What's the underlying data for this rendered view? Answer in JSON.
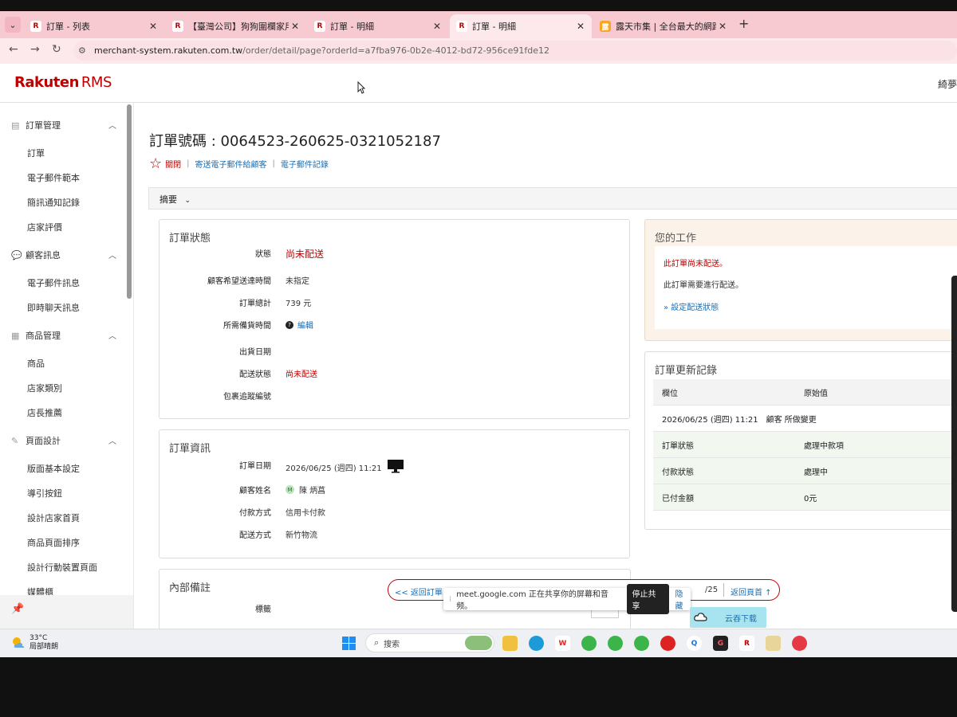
{
  "browser": {
    "tabs": [
      {
        "title": "訂單 - 列表",
        "favicon": "R",
        "active": false
      },
      {
        "title": "【臺灣公司】狗狗圍欄家用狗籠",
        "favicon": "R",
        "active": false
      },
      {
        "title": "訂單 - 明細",
        "favicon": "R",
        "active": false
      },
      {
        "title": "訂單 - 明細",
        "favicon": "R",
        "active": true
      },
      {
        "title": "露天市集 | 全台最大的網路購物",
        "favicon": "Y",
        "active": false
      }
    ],
    "url_host": "merchant-system.rakuten.com.tw",
    "url_path": "/order/detail/page?orderId=a7fba976-0b2e-4012-bd72-956ce91fde12"
  },
  "header": {
    "logo": "Rakuten",
    "logo_suffix": "RMS",
    "user_fragment": "綺夢"
  },
  "sidebar": {
    "sections": [
      {
        "label": "訂單管理",
        "icon": "document-icon",
        "items": [
          "訂單",
          "電子郵件範本",
          "簡訊通知記錄",
          "店家評價"
        ]
      },
      {
        "label": "顧客訊息",
        "icon": "chat-icon",
        "items": [
          "電子郵件訊息",
          "即時聊天訊息"
        ]
      },
      {
        "label": "商品管理",
        "icon": "table-icon",
        "items": [
          "商品",
          "店家類別",
          "店長推薦"
        ]
      },
      {
        "label": "頁面設計",
        "icon": "pencil-icon",
        "items": [
          "版面基本設定",
          "導引按鈕",
          "設計店家首頁",
          "商品頁面排序",
          "設計行動裝置頁面",
          "媒體櫃"
        ]
      }
    ]
  },
  "order": {
    "title": "訂單號碼 : 0064523-260625-0321052187",
    "close_link": "關閉",
    "email_link": "寄送電子郵件給顧客",
    "email_log_link": "電子郵件記錄",
    "summary_label": "摘要"
  },
  "status_card": {
    "title": "訂單狀態",
    "rows": [
      {
        "label": "狀態",
        "value": "尚未配送"
      },
      {
        "label": "顧客希望送達時間",
        "value": "未指定"
      },
      {
        "label": "訂單總計",
        "value": "739 元"
      },
      {
        "label": "所需備貨時間",
        "value": "編輯"
      },
      {
        "label": "出貨日期",
        "value": ""
      },
      {
        "label": "配送狀態",
        "value": "尚未配送"
      },
      {
        "label": "包裹追蹤編號",
        "value": ""
      }
    ]
  },
  "info_card": {
    "title": "訂單資訊",
    "rows": [
      {
        "label": "訂單日期",
        "value": "2026/06/25 (週四) 11:21"
      },
      {
        "label": "顧客姓名",
        "value": "陳 炳菖"
      },
      {
        "label": "付款方式",
        "value": "信用卡付款"
      },
      {
        "label": "配送方式",
        "value": "新竹物流"
      }
    ]
  },
  "notes_card": {
    "title": "內部備註",
    "label": "標籤"
  },
  "tasks": {
    "title": "您的工作",
    "line1": "此訂單尚未配送。",
    "line2": "此訂單需要進行配送。",
    "link": "» 設定配送狀態"
  },
  "history": {
    "title": "訂單更新記錄",
    "head": [
      "欄位",
      "原始值"
    ],
    "event": "2026/06/25 (週四) 11:21　顧客 所做變更",
    "rows": [
      [
        "訂單狀態",
        "處理中款項"
      ],
      [
        "付款狀態",
        "處理中"
      ],
      [
        "已付金額",
        "0元"
      ]
    ]
  },
  "overlay": {
    "back_order": "<< 返回訂單",
    "partial": "/25",
    "back_top": "返回頁首 ↑",
    "share_msg": "meet.google.com 正在共享你的屏幕和音频。",
    "stop_share": "停止共享",
    "hide": "隐藏",
    "cloud": "云吞下载"
  },
  "taskbar": {
    "temp": "33°C",
    "weather": "局部晴朗",
    "search": "搜索"
  },
  "colors": {
    "rakuten_red": "#bf0000",
    "link_blue": "#1a6fb3",
    "tab_pink": "#f7c9d1"
  }
}
